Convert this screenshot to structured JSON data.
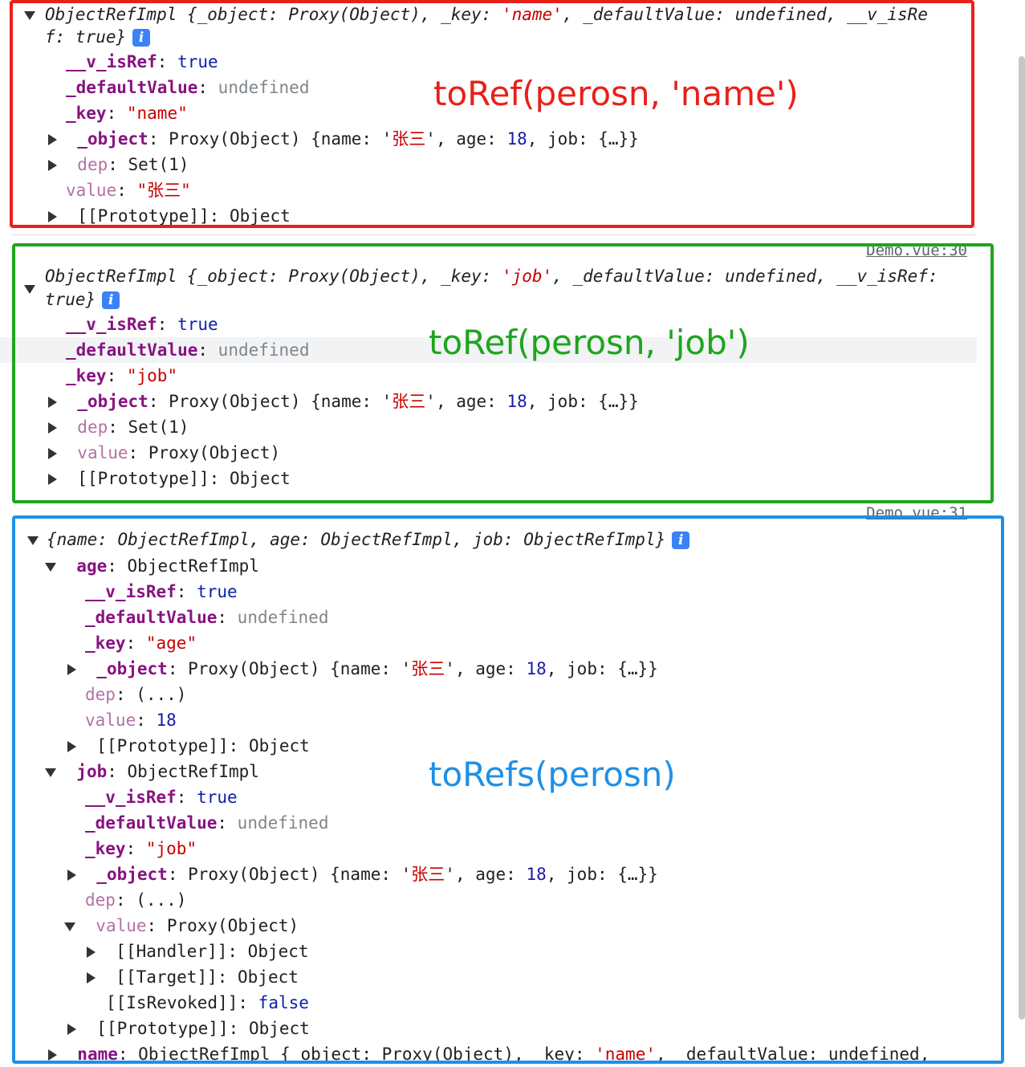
{
  "block1": {
    "summary_1": "ObjectRefImpl {_object: Proxy(Object), _key: ",
    "summary_key": "'name'",
    "summary_2": ", _defaultValue: undefined, __v_isRe",
    "summary_3": "f: true}",
    "rows": [
      {
        "k": "__v_isRef",
        "v": "true"
      },
      {
        "k": "_defaultValue",
        "v": "undefined"
      },
      {
        "k": "_key",
        "v": "\"name\""
      },
      {
        "k": "_object",
        "v": "Proxy(Object)"
      },
      {
        "k": "dep",
        "v": "Set(1)"
      },
      {
        "k": "value",
        "v": "\"张三\""
      },
      {
        "k": "[[Prototype]]",
        "v": "Object"
      }
    ],
    "annotation": "toRef(perosn, 'name')",
    "color": "#e8201a"
  },
  "block2": {
    "source": "Demo.vue:30",
    "summary_1": "ObjectRefImpl {_object: Proxy(Object), _key: ",
    "summary_key": "'job'",
    "summary_2": ", _defaultValue: undefined, __v_isRef:",
    "summary_3": "true}",
    "rows": [
      {
        "k": "__v_isRef",
        "v": "true"
      },
      {
        "k": "_defaultValue",
        "v": "undefined"
      },
      {
        "k": "_key",
        "v": "\"job\""
      },
      {
        "k": "_object",
        "v": "Proxy(Object)"
      },
      {
        "k": "dep",
        "v": "Set(1)"
      },
      {
        "k": "value",
        "v": "Proxy(Object)"
      },
      {
        "k": "[[Prototype]]",
        "v": "Object"
      }
    ],
    "annotation": "toRef(perosn, 'job')",
    "color": "#1ea51e"
  },
  "object_preview": {
    "prefix": "{name: '",
    "name": "张三",
    "mid": "', age: ",
    "age": "18",
    "suffix": ", job: {…}}"
  },
  "block3": {
    "source": "Demo.vue:31",
    "summary": "{name: ObjectRefImpl, age: ObjectRefImpl, job: ObjectRefImpl}",
    "age_label": "age",
    "job_label": "job",
    "type": "ObjectRefImpl",
    "age_rows": [
      {
        "k": "__v_isRef",
        "v": "true"
      },
      {
        "k": "_defaultValue",
        "v": "undefined"
      },
      {
        "k": "_key",
        "v": "\"age\""
      },
      {
        "k": "_object",
        "v": "Proxy(Object)"
      },
      {
        "k": "dep",
        "v": "(...)"
      },
      {
        "k": "value",
        "v": "18"
      },
      {
        "k": "[[Prototype]]",
        "v": "Object"
      }
    ],
    "job_rows": [
      {
        "k": "__v_isRef",
        "v": "true"
      },
      {
        "k": "_defaultValue",
        "v": "undefined"
      },
      {
        "k": "_key",
        "v": "\"job\""
      },
      {
        "k": "_object",
        "v": "Proxy(Object)"
      },
      {
        "k": "dep",
        "v": "(...)"
      },
      {
        "k": "value",
        "v": "Proxy(Object)"
      }
    ],
    "value_children": [
      {
        "k": "[[Handler]]",
        "v": "Object"
      },
      {
        "k": "[[Target]]",
        "v": "Object"
      },
      {
        "k": "[[IsRevoked]]",
        "v": "false"
      }
    ],
    "job_proto": {
      "k": "[[Prototype]]",
      "v": "Object"
    },
    "name_row": {
      "k": "name",
      "v1": "ObjectRefImpl {_object: Proxy(Object), _key: ",
      "v2": "'name'",
      "v3": ", _defaultValue: undefined,"
    },
    "annotation": "toRefs(perosn)",
    "color": "#1e90e8"
  }
}
